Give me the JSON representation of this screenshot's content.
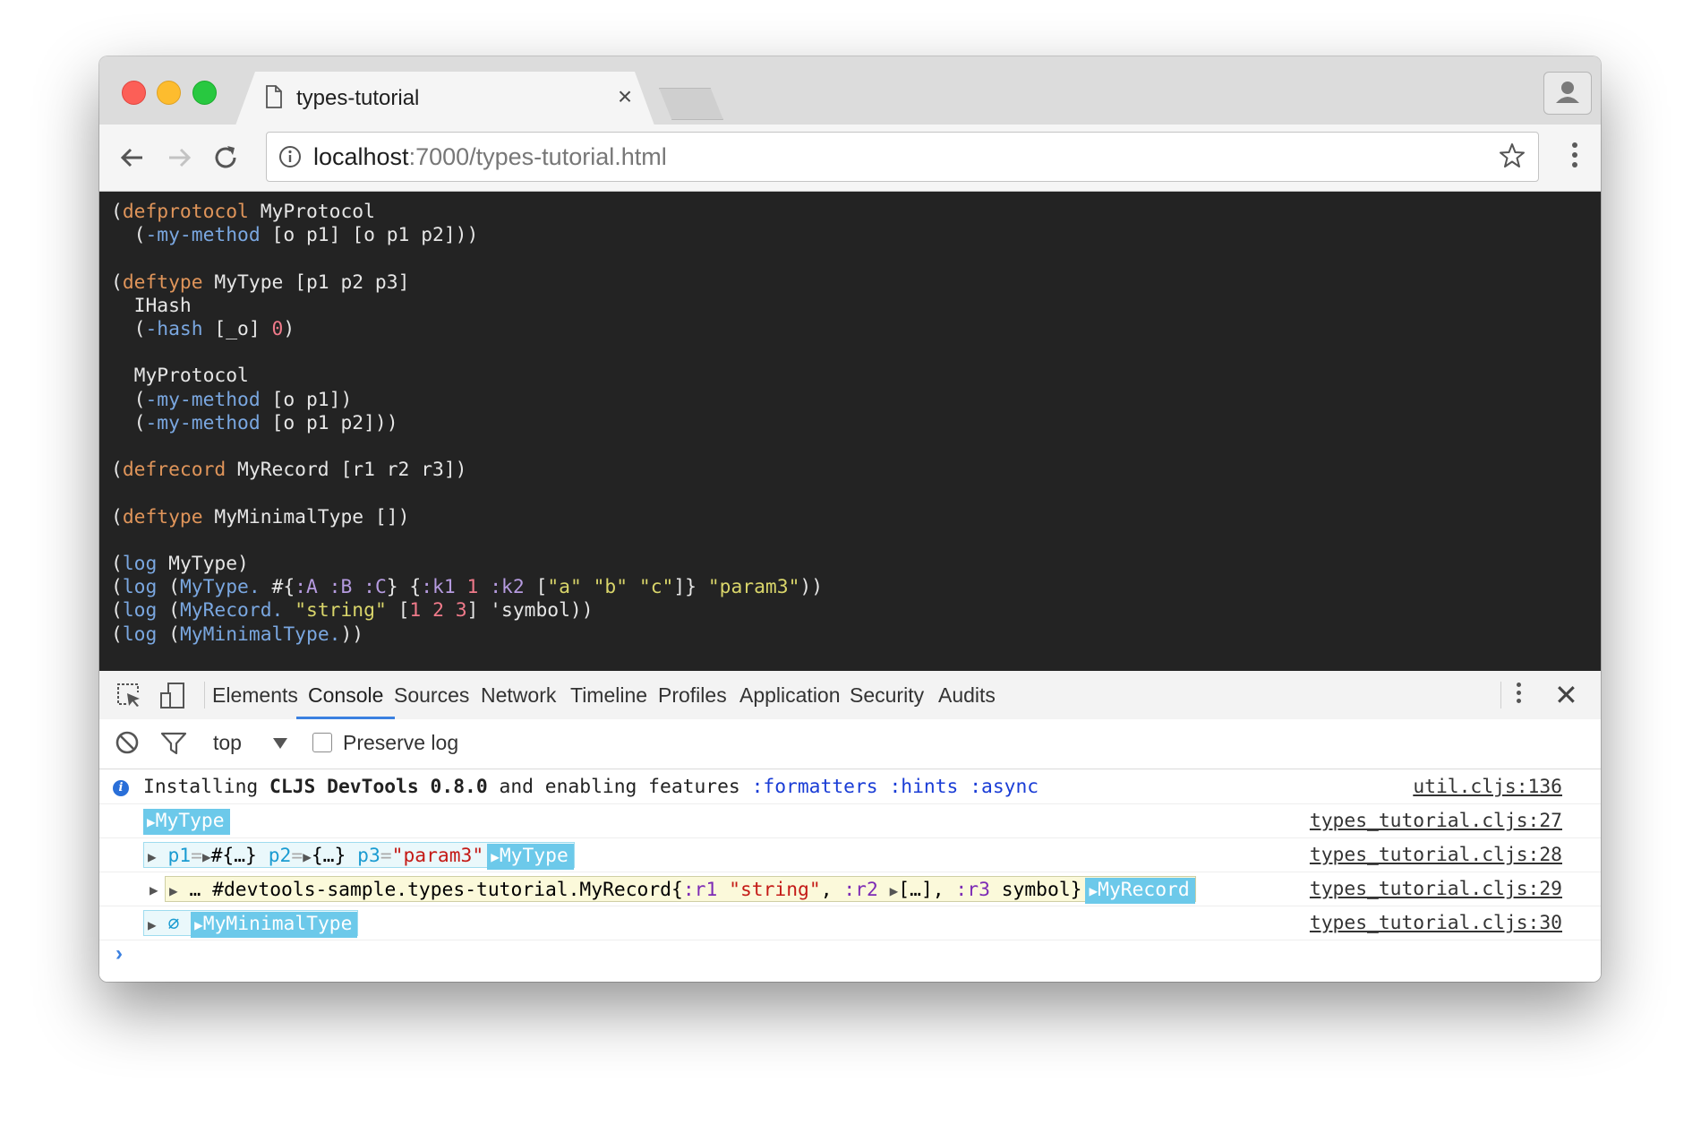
{
  "browser": {
    "tab_title": "types-tutorial",
    "tab_close": "×",
    "url_host": "localhost",
    "url_rest": ":7000/types-tutorial.html"
  },
  "code_lines": [
    [
      {
        "t": "(",
        "c": ""
      },
      {
        "t": "defprotocol",
        "c": "k"
      },
      {
        "t": " MyProtocol",
        "c": ""
      }
    ],
    [
      {
        "t": "  (",
        "c": ""
      },
      {
        "t": "-my-method",
        "c": "f"
      },
      {
        "t": " [o p1] [o p1 p2]))",
        "c": ""
      }
    ],
    [],
    [
      {
        "t": "(",
        "c": ""
      },
      {
        "t": "deftype",
        "c": "k"
      },
      {
        "t": " MyType [p1 p2 p3]",
        "c": ""
      }
    ],
    [
      {
        "t": "  IHash",
        "c": ""
      }
    ],
    [
      {
        "t": "  (",
        "c": ""
      },
      {
        "t": "-hash",
        "c": "f"
      },
      {
        "t": " [_o] ",
        "c": ""
      },
      {
        "t": "0",
        "c": "n"
      },
      {
        "t": ")",
        "c": ""
      }
    ],
    [],
    [
      {
        "t": "  MyProtocol",
        "c": ""
      }
    ],
    [
      {
        "t": "  (",
        "c": ""
      },
      {
        "t": "-my-method",
        "c": "f"
      },
      {
        "t": " [o p1])",
        "c": ""
      }
    ],
    [
      {
        "t": "  (",
        "c": ""
      },
      {
        "t": "-my-method",
        "c": "f"
      },
      {
        "t": " [o p1 p2]))",
        "c": ""
      }
    ],
    [],
    [
      {
        "t": "(",
        "c": ""
      },
      {
        "t": "defrecord",
        "c": "k"
      },
      {
        "t": " MyRecord [r1 r2 r3])",
        "c": ""
      }
    ],
    [],
    [
      {
        "t": "(",
        "c": ""
      },
      {
        "t": "deftype",
        "c": "k"
      },
      {
        "t": " MyMinimalType [])",
        "c": ""
      }
    ],
    [],
    [
      {
        "t": "(",
        "c": ""
      },
      {
        "t": "log",
        "c": "f"
      },
      {
        "t": " MyType)",
        "c": ""
      }
    ],
    [
      {
        "t": "(",
        "c": ""
      },
      {
        "t": "log",
        "c": "f"
      },
      {
        "t": " (",
        "c": ""
      },
      {
        "t": "MyType.",
        "c": "f"
      },
      {
        "t": " #{",
        "c": ""
      },
      {
        "t": ":A :B :C",
        "c": "kw"
      },
      {
        "t": "} {",
        "c": ""
      },
      {
        "t": ":k1",
        "c": "kw"
      },
      {
        "t": " ",
        "c": ""
      },
      {
        "t": "1",
        "c": "n"
      },
      {
        "t": " ",
        "c": ""
      },
      {
        "t": ":k2",
        "c": "kw"
      },
      {
        "t": " [",
        "c": ""
      },
      {
        "t": "\"a\" \"b\" \"c\"",
        "c": "s"
      },
      {
        "t": "]} ",
        "c": ""
      },
      {
        "t": "\"param3\"",
        "c": "s"
      },
      {
        "t": "))",
        "c": ""
      }
    ],
    [
      {
        "t": "(",
        "c": ""
      },
      {
        "t": "log",
        "c": "f"
      },
      {
        "t": " (",
        "c": ""
      },
      {
        "t": "MyRecord.",
        "c": "f"
      },
      {
        "t": " ",
        "c": ""
      },
      {
        "t": "\"string\"",
        "c": "s"
      },
      {
        "t": " [",
        "c": ""
      },
      {
        "t": "1 2 3",
        "c": "n"
      },
      {
        "t": "] 'symbol))",
        "c": ""
      }
    ],
    [
      {
        "t": "(",
        "c": ""
      },
      {
        "t": "log",
        "c": "f"
      },
      {
        "t": " (",
        "c": ""
      },
      {
        "t": "MyMinimalType.",
        "c": "f"
      },
      {
        "t": "))",
        "c": ""
      }
    ]
  ],
  "devtools": {
    "tabs": [
      "Elements",
      "Console",
      "Sources",
      "Network",
      "Timeline",
      "Profiles",
      "Application",
      "Security",
      "Audits"
    ],
    "active_tab": "Console",
    "context": "top",
    "preserve_log": "Preserve log",
    "close": "✕"
  },
  "console": {
    "row1": {
      "pre": "Installing ",
      "bold": "CLJS DevTools 0.8.0",
      "mid": " and enabling features ",
      "features": ":formatters :hints :async",
      "src": "util.cljs:136"
    },
    "row2": {
      "badge": "MyType",
      "src": "types_tutorial.cljs:27"
    },
    "row3": {
      "f1": "p1",
      "v1": "#{…}",
      "f2": "p2",
      "v2": "{…}",
      "f3": "p3",
      "v3": "\"param3\"",
      "badge": "MyType",
      "src": "types_tutorial.cljs:28"
    },
    "row4": {
      "ellipsis": "…",
      "name": "#devtools-sample.types-tutorial.MyRecord",
      "open": "{",
      "k1": ":r1",
      "s1": "\"string\"",
      "c1": ", ",
      "k2": ":r2",
      "v2": "[…]",
      "c2": ", ",
      "k3": ":r3",
      "sym": "symbol",
      "close": "}",
      "badge": "MyRecord",
      "src": "types_tutorial.cljs:29"
    },
    "row5": {
      "nil": "∅",
      "badge": "MyMinimalType",
      "src": "types_tutorial.cljs:30"
    },
    "prompt": "›"
  },
  "icons": [
    "document-icon",
    "back-icon",
    "forward-icon",
    "reload-icon",
    "info-icon",
    "bookmark-star-icon",
    "menu-icon",
    "profile-icon",
    "inspect-icon",
    "device-icon",
    "clear-console-icon",
    "filter-icon",
    "dropdown-icon"
  ]
}
